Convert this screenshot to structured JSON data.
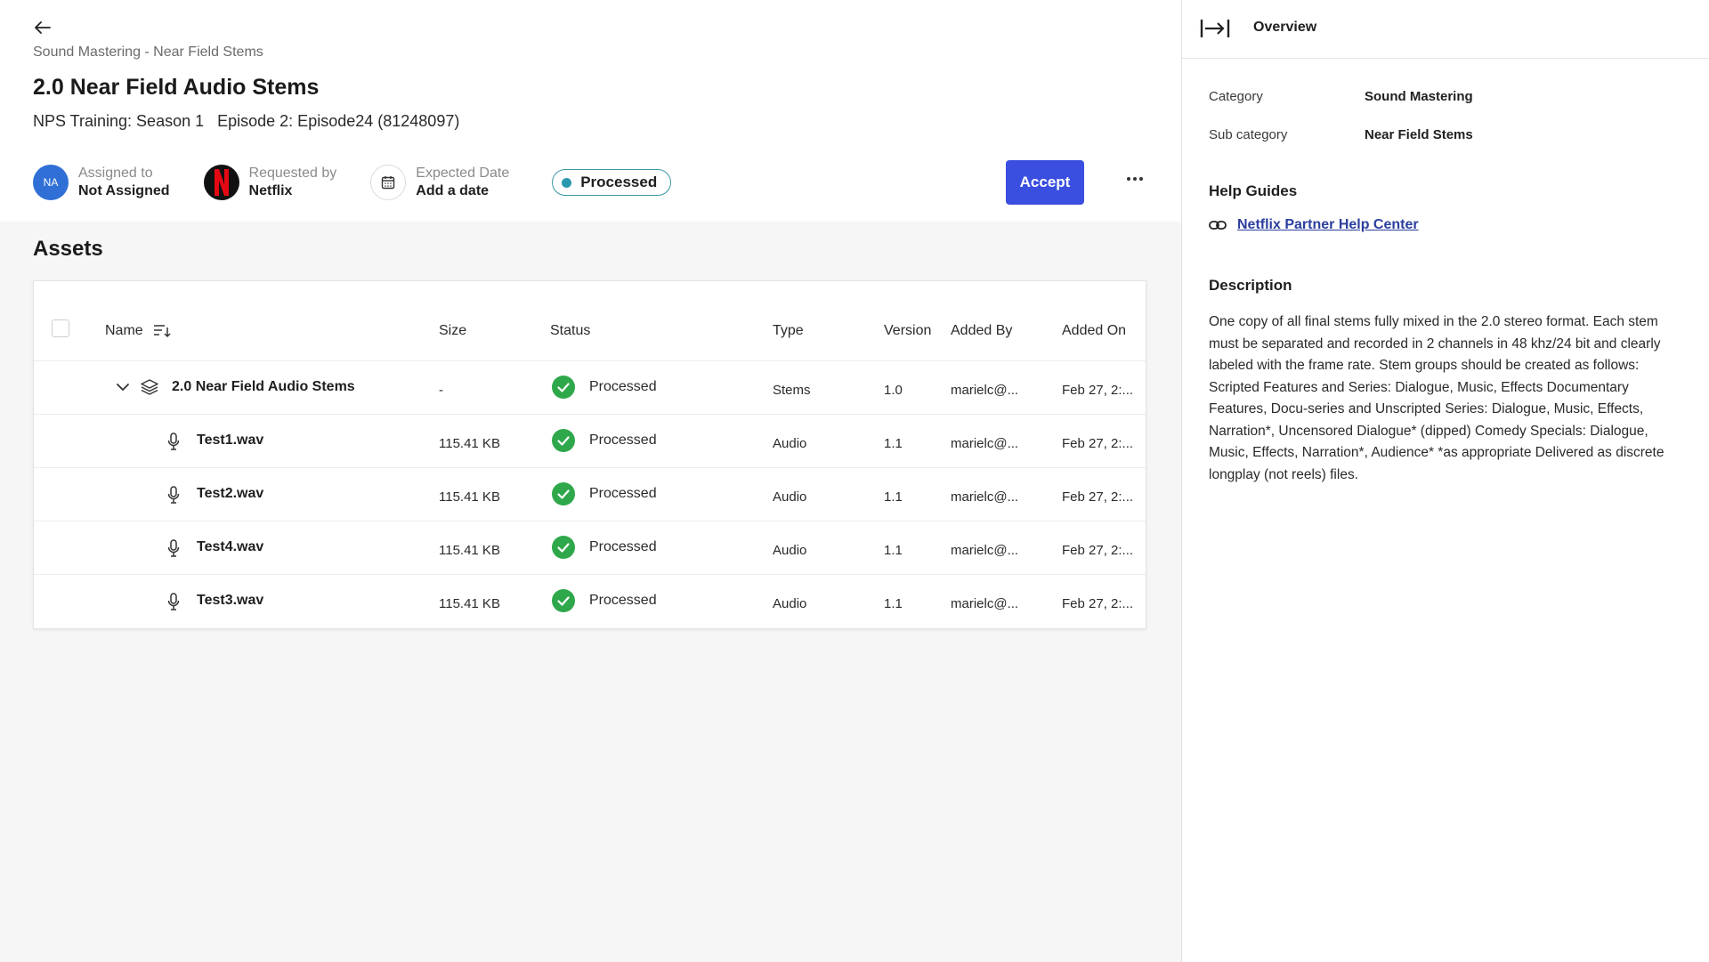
{
  "header": {
    "breadcrumb": "Sound Mastering - Near Field Stems",
    "title": "2.0 Near Field Audio Stems",
    "subtitle_season": "NPS Training: Season 1",
    "subtitle_episode": "Episode 2: Episode24 (81248097)",
    "assigned": {
      "initials": "NA",
      "label": "Assigned to",
      "value": "Not Assigned"
    },
    "requested": {
      "label": "Requested by",
      "value": "Netflix"
    },
    "expected": {
      "label": "Expected Date",
      "value": "Add a date"
    },
    "status": "Processed",
    "accept_label": "Accept"
  },
  "assets": {
    "title": "Assets",
    "columns": {
      "name": "Name",
      "size": "Size",
      "status": "Status",
      "type": "Type",
      "version": "Version",
      "added_by": "Added By",
      "added_on": "Added On"
    },
    "rows": [
      {
        "name": "2.0 Near Field Audio Stems",
        "size": "-",
        "status": "Processed",
        "type": "Stems",
        "version": "1.0",
        "added_by": "marielc@...",
        "added_on": "Feb 27, 2:..."
      },
      {
        "name": "Test1.wav",
        "size": "115.41 KB",
        "status": "Processed",
        "type": "Audio",
        "version": "1.1",
        "added_by": "marielc@...",
        "added_on": "Feb 27, 2:..."
      },
      {
        "name": "Test2.wav",
        "size": "115.41 KB",
        "status": "Processed",
        "type": "Audio",
        "version": "1.1",
        "added_by": "marielc@...",
        "added_on": "Feb 27, 2:..."
      },
      {
        "name": "Test4.wav",
        "size": "115.41 KB",
        "status": "Processed",
        "type": "Audio",
        "version": "1.1",
        "added_by": "marielc@...",
        "added_on": "Feb 27, 2:..."
      },
      {
        "name": "Test3.wav",
        "size": "115.41 KB",
        "status": "Processed",
        "type": "Audio",
        "version": "1.1",
        "added_by": "marielc@...",
        "added_on": "Feb 27, 2:..."
      }
    ]
  },
  "panel": {
    "title": "Overview",
    "category_label": "Category",
    "category_value": "Sound Mastering",
    "subcategory_label": "Sub category",
    "subcategory_value": "Near Field Stems",
    "help_title": "Help Guides",
    "help_link": "Netflix Partner Help Center",
    "description_title": "Description",
    "description": "One copy of all final stems fully mixed in the 2.0 stereo format. Each stem must be separated and recorded in 2 channels in 48 khz/24 bit and clearly labeled with the frame rate. Stem groups should be created as follows: Scripted Features and Series: Dialogue, Music, Effects Documentary Features, Docu-series and Unscripted Series: Dialogue, Music, Effects, Narration*, Uncensored Dialogue* (dipped) Comedy Specials: Dialogue, Music, Effects, Narration*, Audience* *as appropriate Delivered as discrete longplay (not reels) files."
  },
  "colors": {
    "accent": "#3a4ee0",
    "processed_green": "#2ea84a",
    "status_pill_border": "#3a97a3",
    "link": "#2c3e9e"
  }
}
